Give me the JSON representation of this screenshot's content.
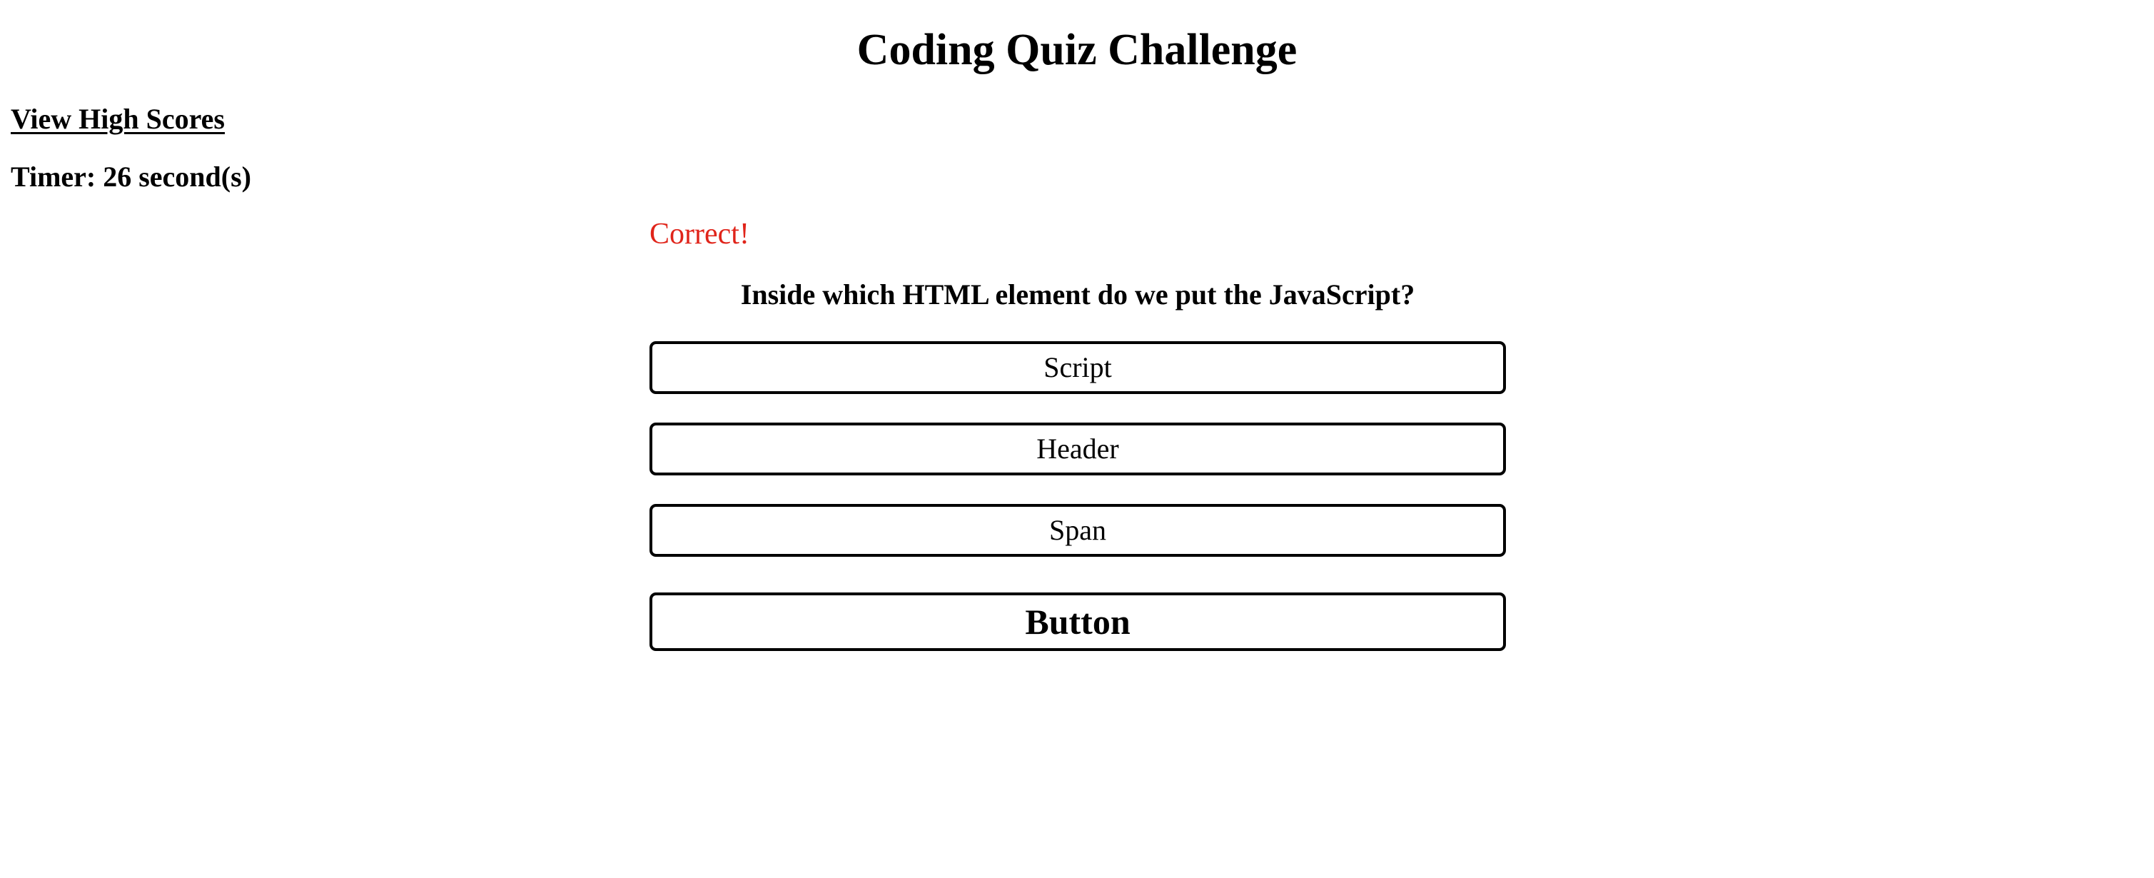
{
  "page": {
    "title": "Coding Quiz Challenge"
  },
  "nav": {
    "high_scores_label": "View High Scores"
  },
  "timer": {
    "text": "Timer: 26 second(s)"
  },
  "feedback": {
    "text": "Correct!",
    "color": "#e0241a"
  },
  "quiz": {
    "question": "Inside which HTML element do we put the JavaScript?",
    "answers": [
      {
        "label": "Script"
      },
      {
        "label": "Header"
      },
      {
        "label": "Span"
      },
      {
        "label": "Button"
      }
    ]
  }
}
